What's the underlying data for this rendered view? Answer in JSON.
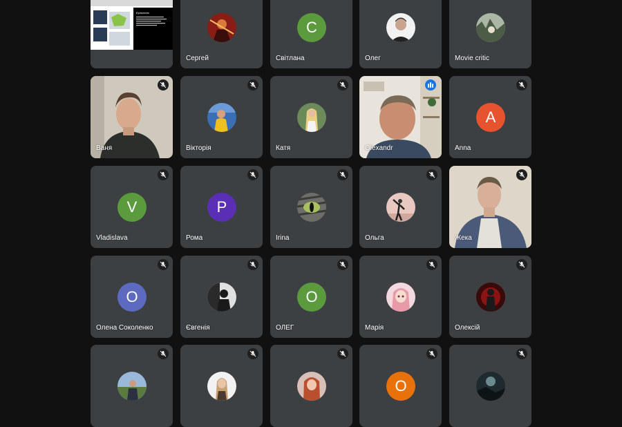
{
  "participants": [
    {
      "name": "",
      "type": "screen"
    },
    {
      "name": "Сергей",
      "type": "photo",
      "icon": "profile-photo-warrior"
    },
    {
      "name": "Світлана",
      "type": "letter",
      "letter": "С",
      "color": "#5c9b3d"
    },
    {
      "name": "Олег",
      "type": "photo",
      "icon": "profile-photo-man"
    },
    {
      "name": "Movie critic",
      "type": "photo",
      "icon": "profile-photo-forest"
    },
    {
      "name": "Ваня",
      "type": "video",
      "icon": "camera-feed-young-man"
    },
    {
      "name": "Вікторія",
      "type": "photo",
      "icon": "profile-photo-girl-yellow"
    },
    {
      "name": "Катя",
      "type": "photo",
      "icon": "profile-photo-blonde-girl"
    },
    {
      "name": "Olexandr",
      "type": "video",
      "icon": "camera-feed-man"
    },
    {
      "name": "Anna",
      "type": "letter",
      "letter": "A",
      "color": "#e8532f"
    },
    {
      "name": "Vladislava",
      "type": "letter",
      "letter": "V",
      "color": "#5c9b3d"
    },
    {
      "name": "Рома",
      "type": "letter",
      "letter": "P",
      "color": "#5b2fb5"
    },
    {
      "name": "Irina",
      "type": "photo",
      "icon": "profile-photo-cat-eye"
    },
    {
      "name": "Ольга",
      "type": "photo",
      "icon": "profile-photo-dancer"
    },
    {
      "name": "Жека",
      "type": "video",
      "icon": "camera-feed-young-man-2"
    },
    {
      "name": "Олена Соколенко",
      "type": "letter",
      "letter": "O",
      "color": "#5c6bc0"
    },
    {
      "name": "Євгенія",
      "type": "photo",
      "icon": "profile-photo-dark-silhouette"
    },
    {
      "name": "ОЛЕГ",
      "type": "letter",
      "letter": "O",
      "color": "#5c9b3d"
    },
    {
      "name": "Марія",
      "type": "photo",
      "icon": "profile-photo-anime-girl"
    },
    {
      "name": "Олексій",
      "type": "photo",
      "icon": "profile-photo-red-figure"
    },
    {
      "name": "",
      "type": "photo",
      "icon": "profile-photo-man-outdoors"
    },
    {
      "name": "",
      "type": "photo",
      "icon": "profile-photo-woman-white"
    },
    {
      "name": "",
      "type": "photo",
      "icon": "profile-photo-woman-red-hair"
    },
    {
      "name": "",
      "type": "letter",
      "letter": "O",
      "color": "#e8710a"
    },
    {
      "name": "",
      "type": "photo",
      "icon": "profile-photo-dark-landscape"
    }
  ],
  "screen_share": {
    "slide_heading": "Ерінгатлія"
  },
  "colors": {
    "background": "#111111",
    "tile": "#3c4043",
    "speaking": "#1a73e8"
  }
}
